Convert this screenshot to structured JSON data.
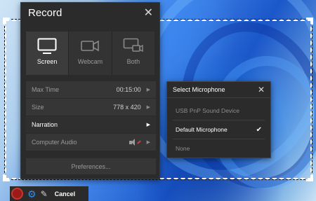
{
  "record_panel": {
    "title": "Record",
    "modes": [
      {
        "label": "Screen",
        "icon": "monitor-icon",
        "active": true
      },
      {
        "label": "Webcam",
        "icon": "webcam-icon",
        "active": false
      },
      {
        "label": "Both",
        "icon": "screen-webcam-icon",
        "active": false
      }
    ],
    "settings": {
      "max_time": {
        "label": "Max Time",
        "value": "00:15:00"
      },
      "size": {
        "label": "Size",
        "value": "778 x 420"
      },
      "narration": {
        "label": "Narration"
      },
      "computer_audio": {
        "label": "Computer Audio",
        "icon": "speaker-muted-icon"
      }
    },
    "preferences_label": "Preferences..."
  },
  "microphone_menu": {
    "title": "Select Microphone",
    "options": [
      {
        "label": "USB PnP Sound Device",
        "selected": false
      },
      {
        "label": "Default Microphone",
        "selected": true
      },
      {
        "label": "None",
        "selected": false
      }
    ]
  },
  "toolbar": {
    "cancel_label": "Cancel",
    "icons": [
      "record-icon",
      "gear-icon",
      "pencil-icon"
    ]
  },
  "colors": {
    "panel_bg": "#2b2b2b",
    "accent_blue": "#2f8fe8",
    "record_red": "#c0392b"
  }
}
